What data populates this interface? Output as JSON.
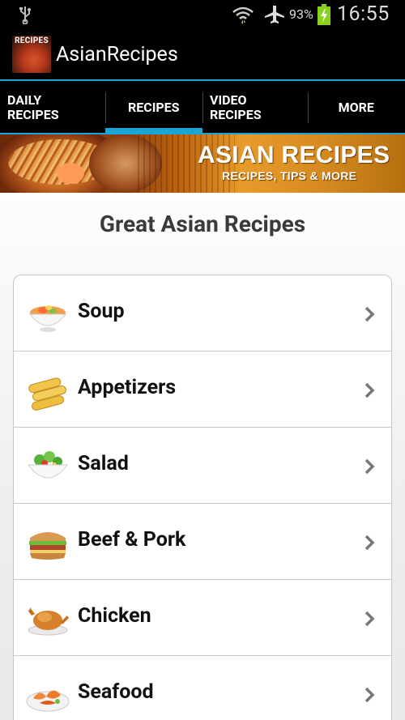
{
  "status_bar": {
    "battery_percent": "93%",
    "time": "16:55",
    "icons": [
      "usb-icon",
      "wifi-icon",
      "airplane-icon",
      "battery-charging-icon"
    ]
  },
  "action_bar": {
    "logo_text": "RECIPES",
    "title": "AsianRecipes"
  },
  "tabs": [
    {
      "line1": "DAILY",
      "line2": "RECIPES"
    },
    {
      "line1": "RECIPES",
      "line2": ""
    },
    {
      "line1": "VIDEO",
      "line2": "RECIPES"
    },
    {
      "line1": "MORE",
      "line2": ""
    }
  ],
  "active_tab": 1,
  "banner": {
    "title": "ASIAN RECIPES",
    "subtitle": "RECIPES, TIPS & MORE"
  },
  "heading": "Great Asian Recipes",
  "categories": [
    {
      "label": "Soup",
      "icon": "soup-bowl-icon"
    },
    {
      "label": "Appetizers",
      "icon": "spring-rolls-icon"
    },
    {
      "label": "Salad",
      "icon": "salad-bowl-icon"
    },
    {
      "label": "Beef & Pork",
      "icon": "sandwich-icon"
    },
    {
      "label": "Chicken",
      "icon": "roast-chicken-icon"
    },
    {
      "label": "Seafood",
      "icon": "seafood-plate-icon"
    }
  ],
  "colors": {
    "accent": "#1aa5d6",
    "bar_background": "#000000",
    "battery": "#8bd11c"
  }
}
